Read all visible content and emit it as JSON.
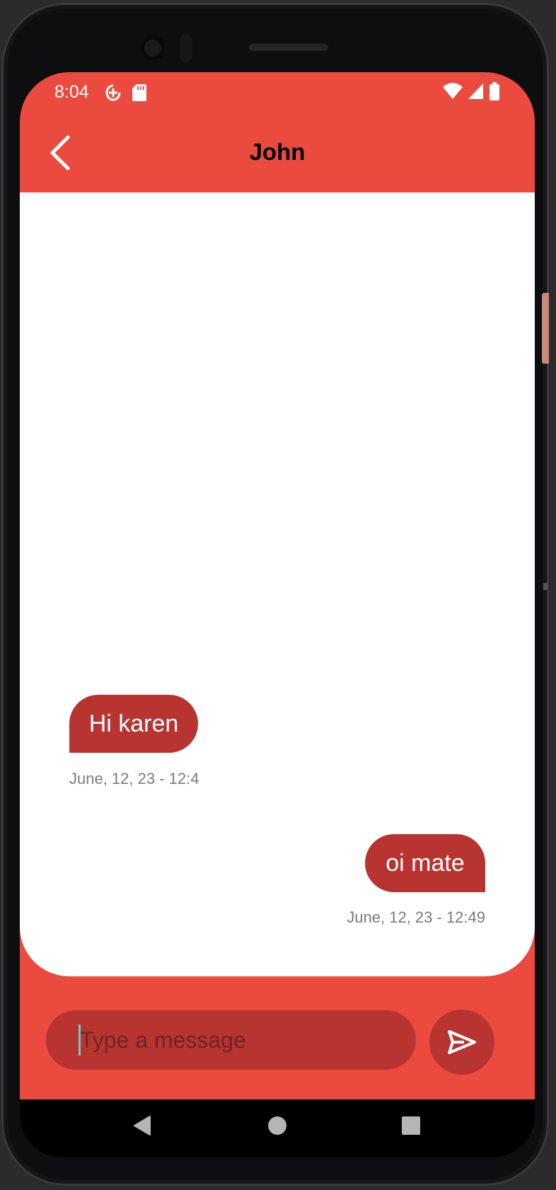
{
  "status_bar": {
    "time": "8:04",
    "left_icons": [
      "data-saver-icon",
      "sd-card-icon"
    ],
    "right_icons": [
      "wifi-icon",
      "cellular-signal-icon",
      "battery-icon"
    ]
  },
  "app_bar": {
    "title": "John",
    "back_icon": "chevron-left-icon"
  },
  "messages": [
    {
      "direction": "incoming",
      "text": "Hi karen",
      "timestamp": "June, 12, 23 - 12:4"
    },
    {
      "direction": "outgoing",
      "text": "oi mate",
      "timestamp": "June, 12, 23 - 12:49"
    }
  ],
  "composer": {
    "placeholder": "Type a message",
    "send_icon": "send-icon"
  },
  "nav_bar": {
    "icons": [
      "back-triangle-icon",
      "home-circle-icon",
      "recents-square-icon"
    ]
  },
  "colors": {
    "primary": "#eb4a3f",
    "bubble": "#b73430",
    "timestamp": "#7b7b7b"
  }
}
